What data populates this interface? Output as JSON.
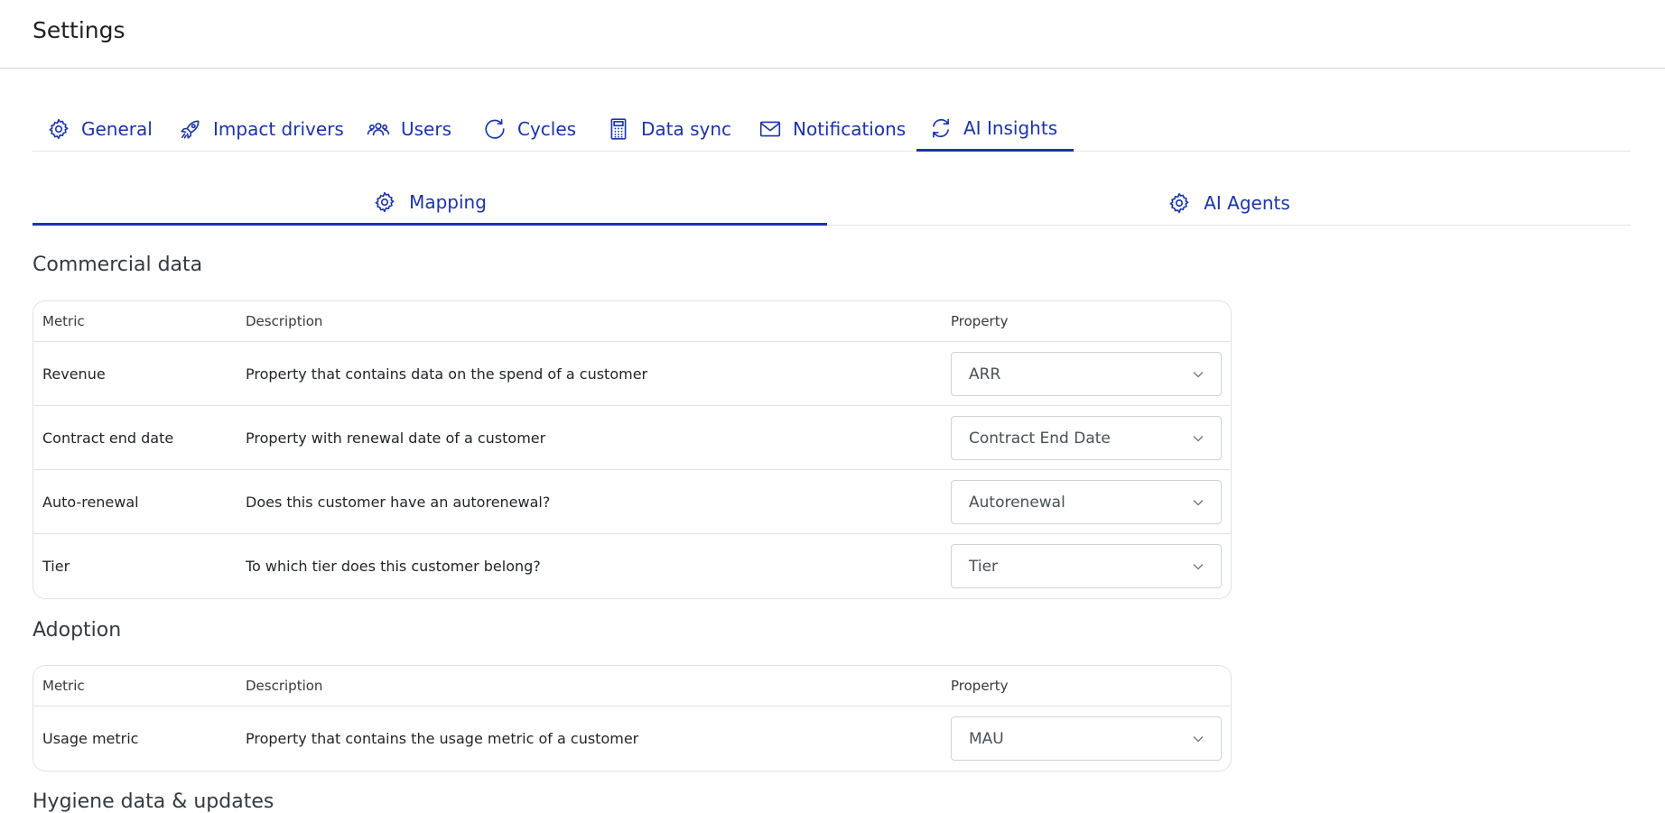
{
  "header": {
    "title": "Settings"
  },
  "tabs": [
    {
      "label": "General",
      "icon": "gear-icon"
    },
    {
      "label": "Impact drivers",
      "icon": "rocket-icon"
    },
    {
      "label": "Users",
      "icon": "users-icon"
    },
    {
      "label": "Cycles",
      "icon": "refresh-icon"
    },
    {
      "label": "Data sync",
      "icon": "calculator-icon"
    },
    {
      "label": "Notifications",
      "icon": "mail-icon"
    },
    {
      "label": "AI Insights",
      "icon": "sync-icon",
      "active": true
    }
  ],
  "subtabs": [
    {
      "label": "Mapping",
      "icon": "gear-icon",
      "active": true
    },
    {
      "label": "AI Agents",
      "icon": "gear-icon"
    }
  ],
  "columns": {
    "metric": "Metric",
    "description": "Description",
    "property": "Property"
  },
  "sections": {
    "commercial": {
      "title": "Commercial data",
      "rows": [
        {
          "metric": "Revenue",
          "description": "Property that contains data on the spend of a customer",
          "property": "ARR"
        },
        {
          "metric": "Contract end date",
          "description": "Property with renewal date of a customer",
          "property": "Contract End Date"
        },
        {
          "metric": "Auto-renewal",
          "description": "Does this customer have an autorenewal?",
          "property": "Autorenewal"
        },
        {
          "metric": "Tier",
          "description": "To which tier does this customer belong?",
          "property": "Tier"
        }
      ]
    },
    "adoption": {
      "title": "Adoption",
      "rows": [
        {
          "metric": "Usage metric",
          "description": "Property that contains the usage metric of a customer",
          "property": "MAU"
        }
      ]
    },
    "hygiene": {
      "title": "Hygiene data & updates"
    }
  },
  "colors": {
    "accent": "#1b34a8",
    "border": "#dfe2e6"
  }
}
